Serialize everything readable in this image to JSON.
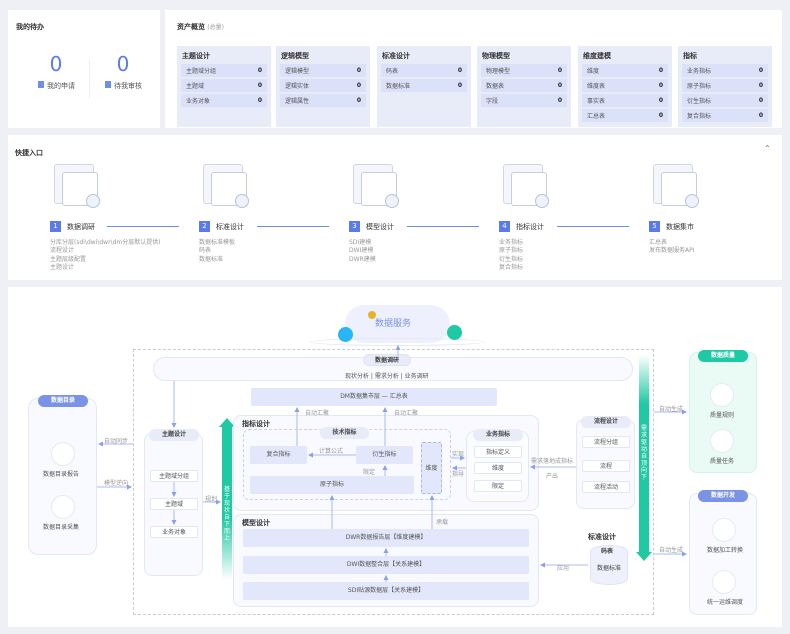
{
  "todo": {
    "title": "我的待办",
    "items": [
      {
        "count": "0",
        "label": "我的申请",
        "icon": "clipboard-icon"
      },
      {
        "count": "0",
        "label": "待我审核",
        "icon": "review-icon"
      }
    ]
  },
  "assets": {
    "title": "资产概览",
    "subtitle": "(总量)",
    "groups": [
      {
        "title": "主题设计",
        "rows": [
          {
            "label": "主题域分组",
            "value": "0"
          },
          {
            "label": "主题域",
            "value": "0"
          },
          {
            "label": "业务对象",
            "value": "0"
          }
        ]
      },
      {
        "title": "逻辑模型",
        "rows": [
          {
            "label": "逻辑模型",
            "value": "0"
          },
          {
            "label": "逻辑实体",
            "value": "0"
          },
          {
            "label": "逻辑属性",
            "value": "0"
          }
        ]
      },
      {
        "title": "标准设计",
        "rows": [
          {
            "label": "码表",
            "value": "0"
          },
          {
            "label": "数据标准",
            "value": "0"
          }
        ]
      },
      {
        "title": "物理模型",
        "rows": [
          {
            "label": "物理模型",
            "value": "0"
          },
          {
            "label": "数据表",
            "value": "0"
          },
          {
            "label": "字段",
            "value": "0"
          }
        ]
      },
      {
        "title": "维度建模",
        "rows": [
          {
            "label": "维度",
            "value": "0"
          },
          {
            "label": "维度表",
            "value": "0"
          },
          {
            "label": "事实表",
            "value": "0"
          },
          {
            "label": "汇总表",
            "value": "0"
          }
        ]
      },
      {
        "title": "指标",
        "rows": [
          {
            "label": "业务指标",
            "value": "0"
          },
          {
            "label": "原子指标",
            "value": "0"
          },
          {
            "label": "衍生指标",
            "value": "0"
          },
          {
            "label": "复合指标",
            "value": "0"
          }
        ]
      }
    ]
  },
  "quick": {
    "title": "快捷入口",
    "steps": [
      {
        "num": "1",
        "label": "数据调研",
        "desc": [
          "分库分层(sdi\\dwi\\dwr\\dm分层默认提供)",
          "流程设计",
          "主题层级配置",
          "主题设计"
        ]
      },
      {
        "num": "2",
        "label": "标准设计",
        "desc": [
          "数据标准模板",
          "码表",
          "数据标准"
        ]
      },
      {
        "num": "3",
        "label": "模型设计",
        "desc": [
          "SDI建模",
          "DWI建模",
          "DWR建模"
        ]
      },
      {
        "num": "4",
        "label": "指标设计",
        "desc": [
          "业务指标",
          "原子指标",
          "衍生指标",
          "复合指标"
        ]
      },
      {
        "num": "5",
        "label": "数据集市",
        "desc": [
          "汇总表",
          "发布数据服务API"
        ]
      }
    ]
  },
  "diagram": {
    "cloud": "数据服务",
    "research": {
      "title": "数据调研",
      "text": "现状分析 | 需求分析 | 业务调研"
    },
    "dm": "DM数据集市层 — 汇总表",
    "catalog": {
      "title": "数据目录",
      "items": [
        "数据目录报告",
        "数据目录采集"
      ]
    },
    "topic": {
      "title": "主题设计",
      "items": [
        "主题域分组",
        "主题域",
        "业务对象"
      ]
    },
    "metric": {
      "title": "指标设计",
      "tech": "技术指标",
      "composite": "复合指标",
      "derived": "衍生指标",
      "atomic": "原子指标",
      "dimension": "维度",
      "formula": "计算公式",
      "limit": "限定",
      "auto1": "自动汇聚",
      "auto2": "自动汇聚"
    },
    "business": {
      "title": "业务指标",
      "items": [
        "指标定义",
        "维度",
        "限定"
      ],
      "impl": "实现",
      "guide": "指导"
    },
    "process": {
      "title": "流程设计",
      "items": [
        "流程分组",
        "流程",
        "流程活动"
      ],
      "arrow": "需求落地成指标",
      "output": "产出"
    },
    "model": {
      "title": "模型设计",
      "layers": [
        "DWR数据报告层【维度建模】",
        "DWI数据整合层【关系建模】",
        "SDI贴源数据层【关系建模】"
      ],
      "carry": "承载"
    },
    "standard": {
      "title": "标准设计",
      "code": "码表",
      "std": "数据标准",
      "apply": "应用"
    },
    "up_arrow": "基于现状 自下而上",
    "down_arrow": "需求驱动 自顶向下",
    "labels": {
      "sync": "自动同步",
      "reverse": "模型逆向",
      "plan": "规划",
      "gen1": "自动生成",
      "gen2": "自动生成"
    },
    "quality": {
      "title": "数据质量",
      "items": [
        "质量规则",
        "质量任务"
      ]
    },
    "dev": {
      "title": "数据开发",
      "items": [
        "数据加工转换",
        "统一运维调度"
      ]
    }
  },
  "colors": {
    "accent": "#5b7be8",
    "green": "#1ec9a3",
    "panel": "#e8ebf8"
  }
}
